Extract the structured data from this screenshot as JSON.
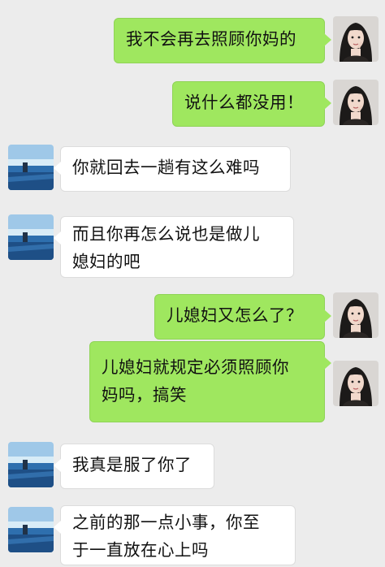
{
  "messages": [
    {
      "sender": "me",
      "lines": [
        "我不会再去照顾你妈的"
      ]
    },
    {
      "sender": "me",
      "lines": [
        "说什么都没用！"
      ]
    },
    {
      "sender": "them",
      "lines": [
        "你就回去一趟有这么难吗"
      ]
    },
    {
      "sender": "them",
      "lines": [
        "而且你再怎么说也是做儿",
        "媳妇的吧"
      ]
    },
    {
      "sender": "me",
      "lines": [
        "儿媳妇又怎么了？"
      ]
    },
    {
      "sender": "me",
      "lines": [
        "儿媳妇就规定必须照顾你",
        "妈吗，搞笑"
      ]
    },
    {
      "sender": "them",
      "lines": [
        "我真是服了你了"
      ]
    },
    {
      "sender": "them",
      "lines": [
        "之前的那一点小事，你至",
        "于一直放在心上吗"
      ]
    }
  ],
  "colors": {
    "background": "#ececec",
    "my_bubble": "#9fe75f",
    "their_bubble": "#ffffff"
  },
  "icons": {
    "my_avatar": "woman-portrait-avatar",
    "their_avatar": "sea-landscape-avatar"
  }
}
